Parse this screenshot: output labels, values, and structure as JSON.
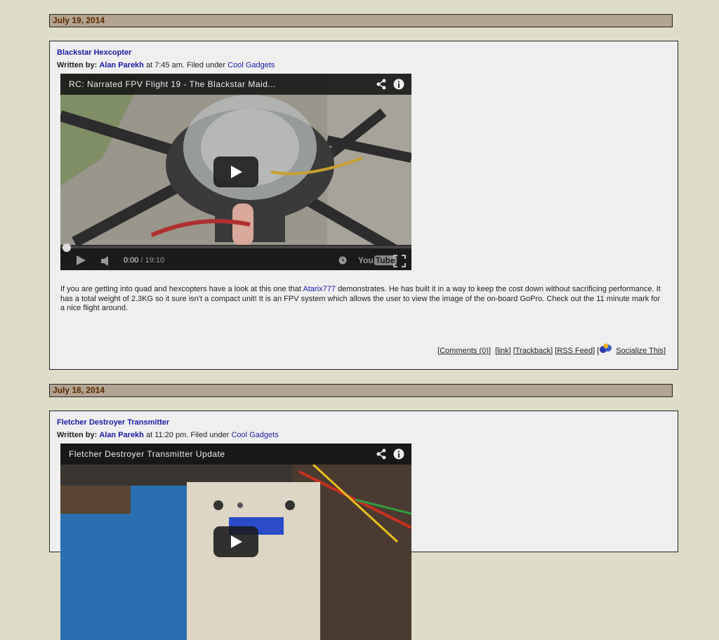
{
  "posts": [
    {
      "date": "July 19, 2014",
      "title": "Blackstar Hexcopter",
      "written_by_label": "Written by:",
      "author": "Alan Parekh",
      "time_text": "at 7:45 am. Filed under",
      "category": "Cool Gadgets",
      "video": {
        "title": "RC: Narrated FPV Flight 19 - The Blackstar Maid...",
        "time_current": "0:00",
        "time_separator": "/",
        "time_total": "19:10",
        "logo_you": "You",
        "logo_tube": "Tube",
        "thumbnail_colors": {
          "sky": "#8a9a70",
          "ground": "#8c8a82",
          "frame": "#2a2a2a",
          "arm": "#3a3a3a"
        }
      },
      "body_parts": {
        "before_link": "If you are getting into quad and hexcopters have a look at this one that ",
        "link_text": "Atarix777",
        "after_link": " demonstrates. He has built it in a way to keep the cost down without sacrificing performance. It has a total weight of 2.3KG so it sure isn't a compact unit! It is an FPV system which allows the user to view the image of the on-board GoPro. Check out the 11 minute mark for a nice flight around."
      },
      "footer": {
        "comments": "Comments (0)",
        "link": "link",
        "trackback": "Trackback",
        "rss": "RSS Feed",
        "socialize": "Socialize This"
      }
    },
    {
      "date": "July 18, 2014",
      "title": "Fletcher Destroyer Transmitter",
      "written_by_label": "Written by:",
      "author": "Alan Parekh",
      "time_text": "at 11:20 pm. Filed under",
      "category": "Cool Gadgets",
      "video": {
        "title": "Fletcher Destroyer Transmitter Update",
        "thumbnail_colors": {
          "bench": "#2a6fb0",
          "box": "#ddd6c4",
          "lcd": "#2a4cc8"
        }
      }
    }
  ],
  "icons": [
    "share-icon",
    "info-icon",
    "play-icon",
    "volume-icon",
    "clock-icon",
    "fullscreen-icon",
    "socialize-icon"
  ]
}
